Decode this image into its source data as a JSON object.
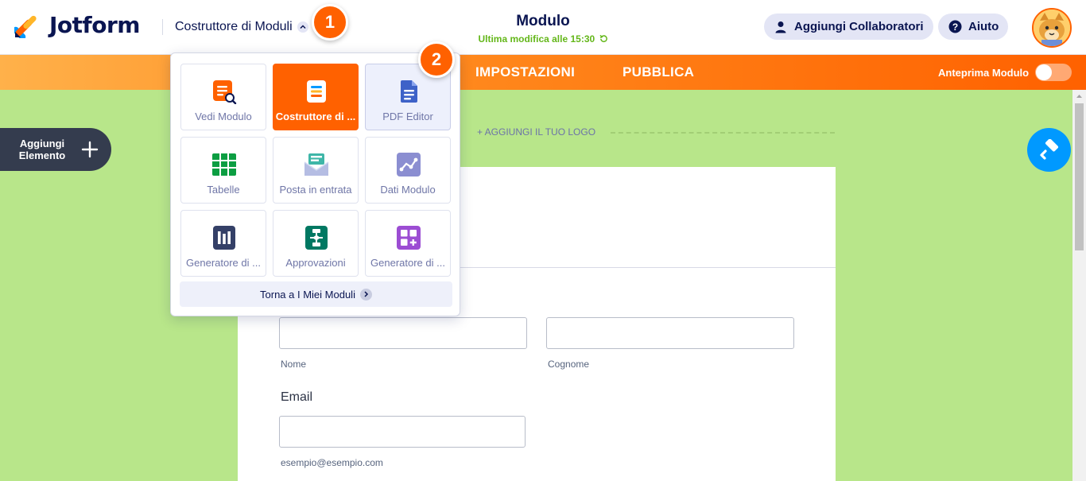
{
  "header": {
    "brand": "Jotform",
    "builder_switch_label": "Costruttore di Moduli",
    "form_title": "Modulo",
    "last_modified": "Ultima modifica alle 15:30",
    "collaborators_label": "Aggiungi Collaboratori",
    "help_label": "Aiuto"
  },
  "nav": {
    "items": [
      {
        "label": "IMPOSTAZIONI"
      },
      {
        "label": "PUBBLICA"
      }
    ],
    "preview_label": "Anteprima Modulo",
    "preview_enabled": false
  },
  "left_panel": {
    "add_element_label": "Aggiungi Elemento"
  },
  "canvas": {
    "add_logo_label": "+ AGGIUNGI IL TUO LOGO",
    "first_name_sublabel": "Nome",
    "last_name_sublabel": "Cognome",
    "email_label": "Email",
    "email_sublabel": "esempio@esempio.com"
  },
  "app_switcher": {
    "tiles": [
      {
        "label": "Vedi Modulo",
        "icon": "view-form-icon",
        "color": "#ff6100"
      },
      {
        "label": "Costruttore di ...",
        "icon": "form-builder-icon",
        "color": "#ff6100",
        "active": true
      },
      {
        "label": "PDF Editor",
        "icon": "pdf-editor-icon",
        "color": "#3e62c8"
      },
      {
        "label": "Tabelle",
        "icon": "tables-icon",
        "color": "#0c9e42"
      },
      {
        "label": "Posta in entrata",
        "icon": "inbox-icon",
        "color": "#3fb6a8"
      },
      {
        "label": "Dati Modulo",
        "icon": "form-data-icon",
        "color": "#8b8ed1"
      },
      {
        "label": "Generatore di ...",
        "icon": "report-builder-icon",
        "color": "#344067"
      },
      {
        "label": "Approvazioni",
        "icon": "approvals-icon",
        "color": "#007862"
      },
      {
        "label": "Generatore di ...",
        "icon": "app-builder-icon",
        "color": "#9c4dd3"
      }
    ],
    "back_label": "Torna a I Miei Moduli"
  },
  "annotations": {
    "step1": "1",
    "step2": "2"
  },
  "colors": {
    "accent": "#ff6100",
    "navy": "#0a1551",
    "canvas_bg": "#b8e68a",
    "paint_button": "#0099ff"
  }
}
